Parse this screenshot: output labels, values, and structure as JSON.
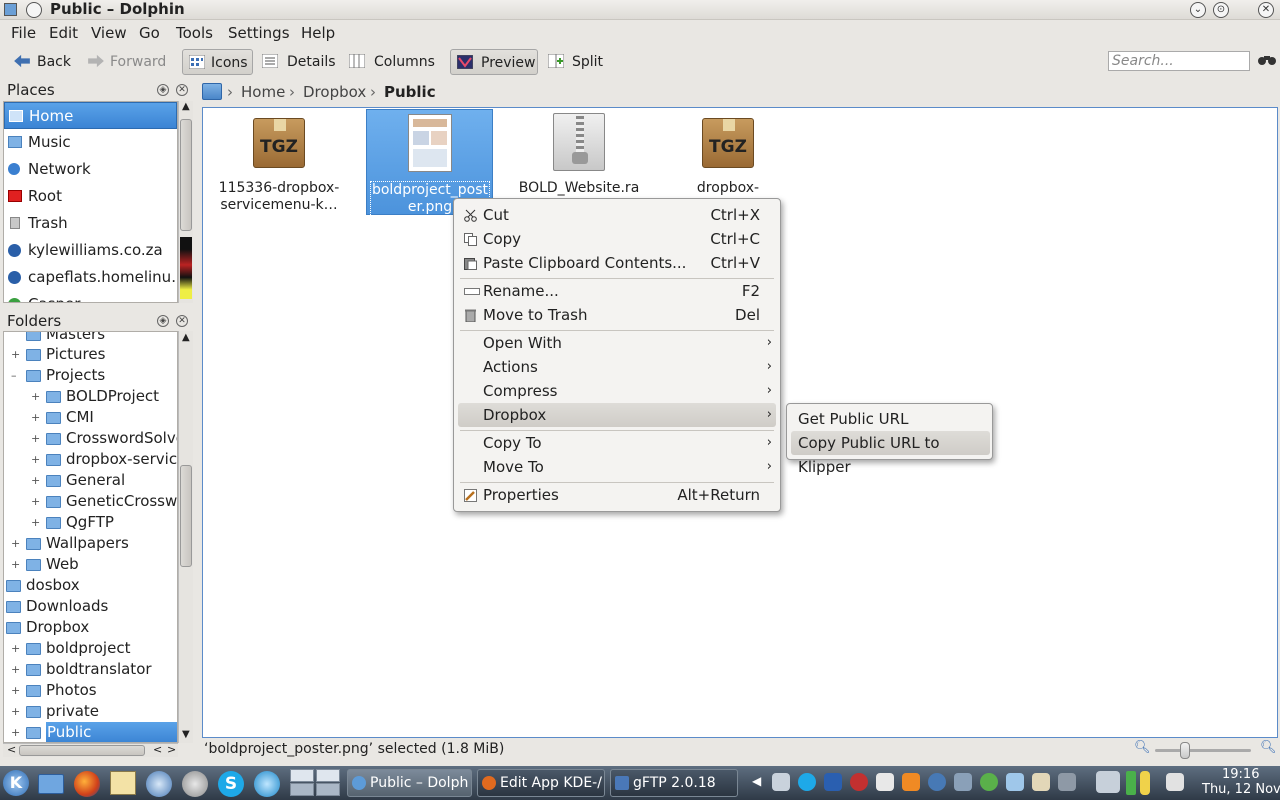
{
  "window": {
    "title": "Public – Dolphin"
  },
  "menubar": [
    "File",
    "Edit",
    "View",
    "Go",
    "Tools",
    "Settings",
    "Help"
  ],
  "toolbar": {
    "back": "Back",
    "forward": "Forward",
    "icons": "Icons",
    "details": "Details",
    "columns": "Columns",
    "preview": "Preview",
    "split": "Split",
    "search_placeholder": "Search..."
  },
  "places": {
    "title": "Places",
    "items": [
      "Home",
      "Music",
      "Network",
      "Root",
      "Trash",
      "kylewilliams.co.za",
      "capeflats.homelinu…",
      "Casper"
    ]
  },
  "folders": {
    "title": "Folders",
    "items": [
      "Masters",
      "Pictures",
      "Projects",
      "BOLDProject",
      "CMI",
      "CrosswordSolve",
      "dropbox-service",
      "General",
      "GeneticCrosswo",
      "QgFTP",
      "Wallpapers",
      "Web",
      "dosbox",
      "Downloads",
      "Dropbox",
      "boldproject",
      "boldtranslator",
      "Photos",
      "private",
      "Public"
    ]
  },
  "breadcrumb": {
    "home": "Home",
    "dropbox": "Dropbox",
    "current": "Public"
  },
  "files": [
    {
      "line1": "115336-dropbox-",
      "line2": "servicemenu-k…",
      "icon": "TGZ"
    },
    {
      "line1": "boldproject_post",
      "line2": "er.png",
      "icon": "image-thumbnail"
    },
    {
      "line1": "BOLD_Website.ra",
      "line2": "",
      "icon": "zip-archive"
    },
    {
      "line1": "dropbox-",
      "line2": "",
      "icon": "TGZ"
    }
  ],
  "context_menu": {
    "cut": "Cut",
    "cut_sc": "Ctrl+X",
    "copy": "Copy",
    "copy_sc": "Ctrl+C",
    "paste": "Paste Clipboard Contents...",
    "paste_sc": "Ctrl+V",
    "rename": "Rename...",
    "rename_sc": "F2",
    "trash": "Move to Trash",
    "trash_sc": "Del",
    "open_with": "Open With",
    "actions": "Actions",
    "compress": "Compress",
    "dropbox": "Dropbox",
    "copy_to": "Copy To",
    "move_to": "Move To",
    "properties": "Properties",
    "properties_sc": "Alt+Return"
  },
  "submenu": {
    "get_url": "Get Public URL",
    "copy_url": "Copy Public URL to Klipper"
  },
  "status": {
    "text": "‘boldproject_poster.png’ selected (1.8 MiB)",
    "zoom": 0.31
  },
  "taskbar": {
    "tasks": [
      "Public – Dolph",
      "Edit App KDE-/",
      "gFTP 2.0.18"
    ],
    "time": "19:16",
    "date": "Thu, 12 Nov"
  },
  "colors": {
    "accent": "#3b84d4",
    "taskbar": "#3a4654"
  }
}
